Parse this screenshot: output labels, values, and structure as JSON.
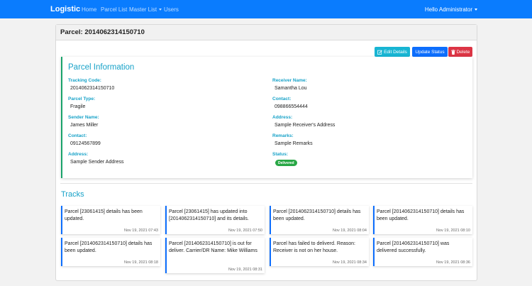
{
  "navbar": {
    "brand": "Logistic",
    "links": [
      "Home",
      "Parcel List",
      "Master List",
      "Users"
    ],
    "user": "Hello Administrator",
    "color": "#0a7cfe"
  },
  "header": {
    "title": "Parcel: 2014062314150710"
  },
  "actions": {
    "edit": "Edit Details",
    "update": "Update Status",
    "delete": "Delete"
  },
  "info": {
    "title": "Parcel Information",
    "tracking_code_label": "Tracking Code:",
    "tracking_code": "2014062314150710",
    "parcel_type_label": "Parcel Type:",
    "parcel_type": "Fragile",
    "sender_name_label": "Sender Name:",
    "sender_name": "James Miller",
    "sender_contact_label": "Contact:",
    "sender_contact": "09124567899",
    "sender_address_label": "Address:",
    "sender_address": "Sample Sender Address",
    "receiver_name_label": "Receiver Name:",
    "receiver_name": "Samantha Lou",
    "receiver_contact_label": "Contact:",
    "receiver_contact": "098866554444",
    "receiver_address_label": "Address:",
    "receiver_address": "Sample Receiver's Address",
    "remarks_label": "Remarks:",
    "remarks": "Sample Remarks",
    "status_label": "Status:",
    "status": "Delivered",
    "label_color": "#17a2c8",
    "status_color": "#28a745"
  },
  "tracks": {
    "title": "Tracks",
    "items": [
      {
        "text": "Parcel [23061415] details has been updated.",
        "date": "Nov 19, 2021 07:43"
      },
      {
        "text": "Parcel [23061415] has updated into [2014062314150710] and its details.",
        "date": "Nov 19, 2021 07:50"
      },
      {
        "text": "Parcel [2014062314150710] details has been updated.",
        "date": "Nov 19, 2021 08:04"
      },
      {
        "text": "Parcel [2014062314150710] details has been updated.",
        "date": "Nov 19, 2021 08:10"
      },
      {
        "text": "Parcel [2014062314150710] details has been updated.",
        "date": "Nov 19, 2021 08:18"
      },
      {
        "text": "Parcel [2014062314150710] is out for deliver. Carrier/DR Name: Mike Williams",
        "date": "Nov 19, 2021 08:31"
      },
      {
        "text": "Parcel has failed to deliverd. Reason: Receiver is not on her house.",
        "date": "Nov 19, 2021 08:34"
      },
      {
        "text": "Parcel [2014062314150710] was delivered successfully.",
        "date": "Nov 19, 2021 08:36"
      }
    ]
  }
}
